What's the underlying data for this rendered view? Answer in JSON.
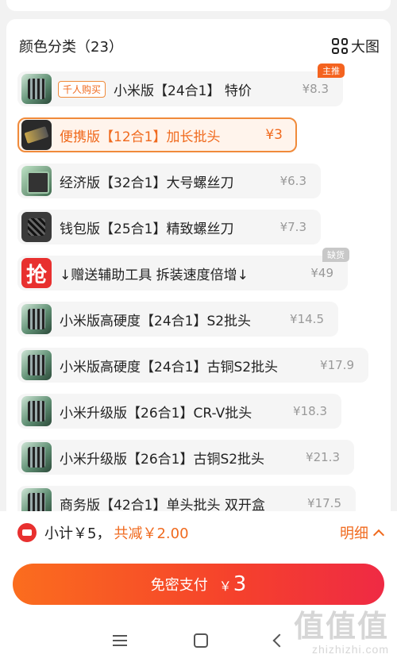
{
  "section": {
    "title": "颜色分类（23）",
    "view_toggle_label": "大图"
  },
  "options": [
    {
      "tag": "千人购买",
      "name": "小米版【24合1】 特价",
      "price": "¥8.3",
      "badge": "主推",
      "badge_type": "hot",
      "thumb": "green",
      "selected": false
    },
    {
      "tag": "",
      "name": "便携版【12合1】加长批头",
      "price": "¥3",
      "badge": "",
      "thumb": "dark",
      "selected": true
    },
    {
      "tag": "",
      "name": "经济版【32合1】大号螺丝刀",
      "price": "¥6.3",
      "badge": "",
      "thumb": "box",
      "selected": false
    },
    {
      "tag": "",
      "name": "钱包版【25合1】精致螺丝刀",
      "price": "¥7.3",
      "badge": "",
      "thumb": "pouch",
      "selected": false
    },
    {
      "tag": "",
      "name": "↓赠送辅助工具 拆装速度倍增↓",
      "price": "¥49",
      "badge": "缺货",
      "badge_type": "out",
      "thumb": "promo",
      "thumb_text": "抢",
      "selected": false
    },
    {
      "tag": "",
      "name": "小米版高硬度【24合1】S2批头",
      "price": "¥14.5",
      "badge": "",
      "thumb": "green",
      "selected": false
    },
    {
      "tag": "",
      "name": "小米版高硬度【24合1】古铜S2批头",
      "price": "¥17.9",
      "badge": "",
      "thumb": "green",
      "selected": false
    },
    {
      "tag": "",
      "name": "小米升级版【26合1】CR-V批头",
      "price": "¥18.3",
      "badge": "",
      "thumb": "green",
      "selected": false
    },
    {
      "tag": "",
      "name": "小米升级版【26合1】古铜S2批头",
      "price": "¥21.3",
      "badge": "",
      "thumb": "green",
      "selected": false
    },
    {
      "tag": "",
      "name": "商务版【42合1】单头批头 双开盒",
      "price": "¥17.5",
      "badge": "",
      "thumb": "green",
      "selected": false
    }
  ],
  "summary": {
    "subtotal": "小计￥5，",
    "discount": "共减￥2.00",
    "detail_label": "明细"
  },
  "pay": {
    "label": "免密支付",
    "currency": "￥",
    "amount": "3"
  },
  "watermark": {
    "logo": "值值值",
    "url": "zhizhizhi.com"
  },
  "colors": {
    "accent": "#f06a1e",
    "pay_gradient_start": "#fb6d1e",
    "pay_gradient_end": "#ef2a44"
  }
}
